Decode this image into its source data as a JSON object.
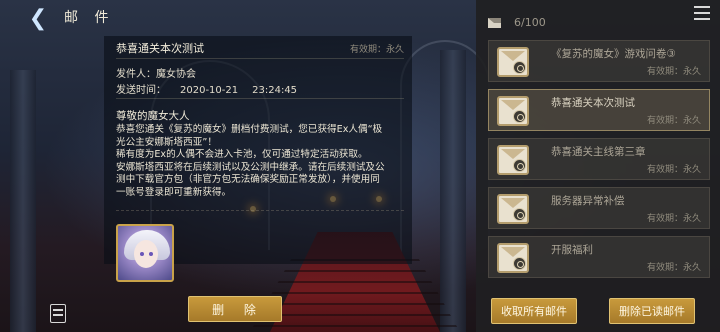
{
  "header": {
    "back_icon": "chevron-left-icon",
    "title": "邮 件"
  },
  "detail": {
    "subject": "恭喜通关本次测试",
    "validity": "有效期：永久",
    "sender": "发件人：魔女协会",
    "send_time_label": "发送时间：",
    "send_date": "2020-10-21",
    "send_clock": "23:24:45",
    "greeting": "尊敬的魔女大人",
    "body": "恭喜您通关《复苏的魔女》删档付费测试，您已获得Ex人偶“极\n光公主安娜斯塔西亚”！\n稀有度为Ex的人偶不会进入卡池，仅可通过特定活动获取。\n安娜斯塔西亚将在后续测试以及公测中继承。请在后续测试及公\n测中下载官方包（非官方包无法确保奖励正常发放），并使用同\n一账号登录即可重新获得。",
    "delete_label": "删 除"
  },
  "list_panel": {
    "count": "6/100",
    "items": [
      {
        "title": "《复苏的魔女》游戏问卷③",
        "validity": "有效期：永久",
        "selected": false,
        "read": true
      },
      {
        "title": "恭喜通关本次测试",
        "validity": "有效期：永久",
        "selected": true,
        "read": true
      },
      {
        "title": "恭喜通关主线第三章",
        "validity": "有效期：永久",
        "selected": false,
        "read": true
      },
      {
        "title": "服务器异常补偿",
        "validity": "有效期：永久",
        "selected": false,
        "read": true
      },
      {
        "title": "开服福利",
        "validity": "有效期：永久",
        "selected": false,
        "read": true
      }
    ],
    "collect_all_label": "收取所有邮件",
    "delete_read_label": "删除已读邮件"
  },
  "colors": {
    "gold_button": "#b8893a",
    "panel_dark": "#202022",
    "accent_border": "#d6be82"
  }
}
